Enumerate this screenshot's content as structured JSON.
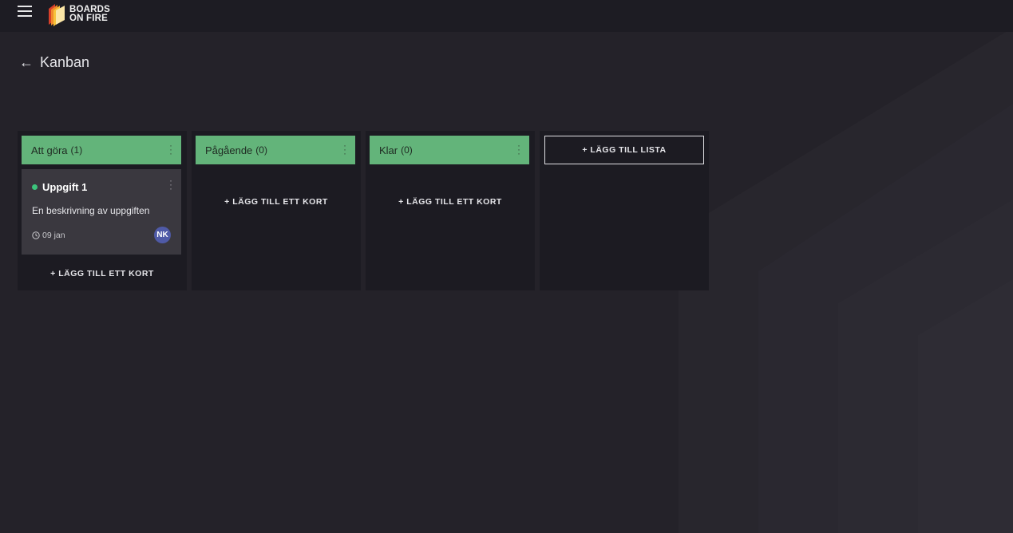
{
  "header": {
    "brand_line1": "BOARDS",
    "brand_line2": "ON FIRE"
  },
  "page": {
    "title": "Kanban"
  },
  "lists": [
    {
      "title": "Att göra",
      "count": "(1)",
      "add_card": "+ LÄGG TILL ETT KORT",
      "cards": [
        {
          "title": "Uppgift 1",
          "description": "En beskrivning av uppgiften",
          "date": "09 jan",
          "assignee": "NK",
          "status_color": "#3cc47c"
        }
      ]
    },
    {
      "title": "Pågående",
      "count": "(0)",
      "add_card": "+ LÄGG TILL ETT KORT"
    },
    {
      "title": "Klar",
      "count": "(0)",
      "add_card": "+ LÄGG TILL ETT KORT"
    }
  ],
  "add_list": "+ LÄGG TILL LISTA",
  "colors": {
    "list_header": "#63b47a",
    "background": "#242229",
    "card": "#3a383f",
    "avatar": "#4f5aa7"
  }
}
